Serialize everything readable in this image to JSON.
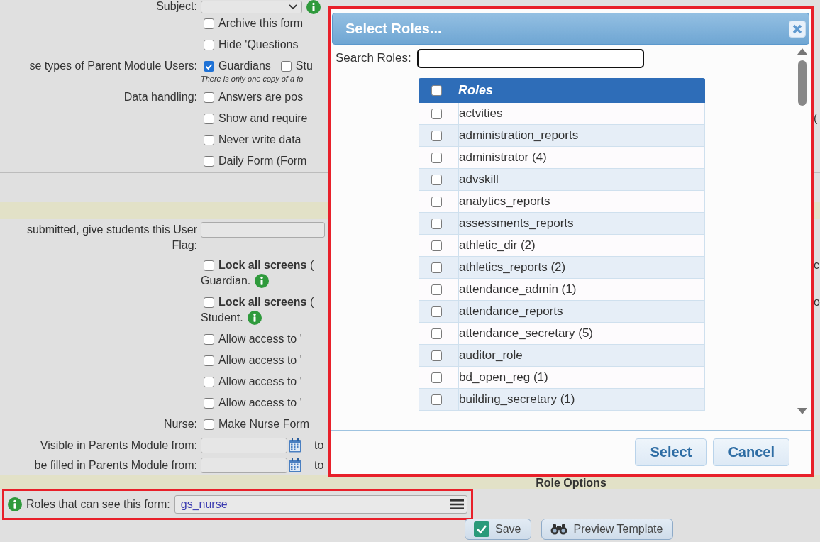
{
  "form": {
    "top_rows": [
      {
        "kind": "select",
        "label": "Subject:"
      },
      {
        "kind": "checks",
        "items": [
          {
            "text": "Archive this form",
            "checked": false
          }
        ]
      },
      {
        "kind": "checks",
        "items": [
          {
            "text": "Hide 'Questions",
            "checked": false
          }
        ]
      },
      {
        "kind": "checks",
        "label": "se types of Parent Module Users:",
        "items": [
          {
            "text": "Guardians",
            "checked": true
          },
          {
            "text": "Stu",
            "checked": false
          }
        ],
        "note": "There is only one copy of a fo"
      },
      {
        "kind": "checks",
        "label": "Data handling:",
        "items": [
          {
            "text": "Answers are pos",
            "checked": false
          }
        ]
      },
      {
        "kind": "checks",
        "items": [
          {
            "text": "Show and require",
            "checked": false
          }
        ],
        "tail": "("
      },
      {
        "kind": "checks",
        "items": [
          {
            "text": "Never write data",
            "checked": false
          }
        ]
      },
      {
        "kind": "checks",
        "items": [
          {
            "text": "Daily Form (Form",
            "checked": false
          }
        ]
      }
    ],
    "middle_rows": [
      {
        "kind": "textfield",
        "label": "submitted, give students this User\nFlag:"
      },
      {
        "kind": "lock",
        "items": [
          {
            "text": "**Lock all screens** (",
            "checked": false
          }
        ],
        "continuation": "Guardian.",
        "tail": "c"
      },
      {
        "kind": "lock",
        "items": [
          {
            "text": "**Lock all screens** (",
            "checked": false
          }
        ],
        "continuation": "Student.",
        "tail": "o"
      },
      {
        "kind": "checks",
        "items": [
          {
            "text": "Allow access to '",
            "checked": false
          }
        ]
      },
      {
        "kind": "checks",
        "items": [
          {
            "text": "Allow access to '",
            "checked": false
          }
        ]
      },
      {
        "kind": "checks",
        "items": [
          {
            "text": "Allow access to '",
            "checked": false
          }
        ]
      },
      {
        "kind": "checks",
        "items": [
          {
            "text": "Allow access to '",
            "checked": false
          }
        ]
      },
      {
        "kind": "checks",
        "label": "Nurse:",
        "items": [
          {
            "text": "Make Nurse Form",
            "checked": false
          }
        ]
      },
      {
        "kind": "date",
        "label": "Visible in Parents Module from:",
        "to": "to"
      },
      {
        "kind": "date",
        "label": "be filled in Parents Module from:",
        "to": "to"
      }
    ],
    "section_title": "Role Options",
    "roles_field": {
      "label": "Roles that can see this form:",
      "value": "gs_nurse"
    },
    "buttons": [
      {
        "kind": "save",
        "label": "Save"
      },
      {
        "kind": "preview",
        "label": "Preview Template"
      }
    ]
  },
  "dialog": {
    "title": "Select Roles...",
    "search_label": "Search Roles:",
    "column": "Roles",
    "all_checked": false,
    "roles": [
      {
        "name": "actvities",
        "checked": false
      },
      {
        "name": "administration_reports",
        "checked": false
      },
      {
        "name": "administrator (4)",
        "checked": false
      },
      {
        "name": "advskill",
        "checked": false
      },
      {
        "name": "analytics_reports",
        "checked": false
      },
      {
        "name": "assessments_reports",
        "checked": false
      },
      {
        "name": "athletic_dir (2)",
        "checked": false
      },
      {
        "name": "athletics_reports (2)",
        "checked": false
      },
      {
        "name": "attendance_admin (1)",
        "checked": false
      },
      {
        "name": "attendance_reports",
        "checked": false
      },
      {
        "name": "attendance_secretary (5)",
        "checked": false
      },
      {
        "name": "auditor_role",
        "checked": false
      },
      {
        "name": "bd_open_reg (1)",
        "checked": false
      },
      {
        "name": "building_secretary (1)",
        "checked": false
      }
    ],
    "buttons": [
      "Select",
      "Cancel"
    ]
  }
}
